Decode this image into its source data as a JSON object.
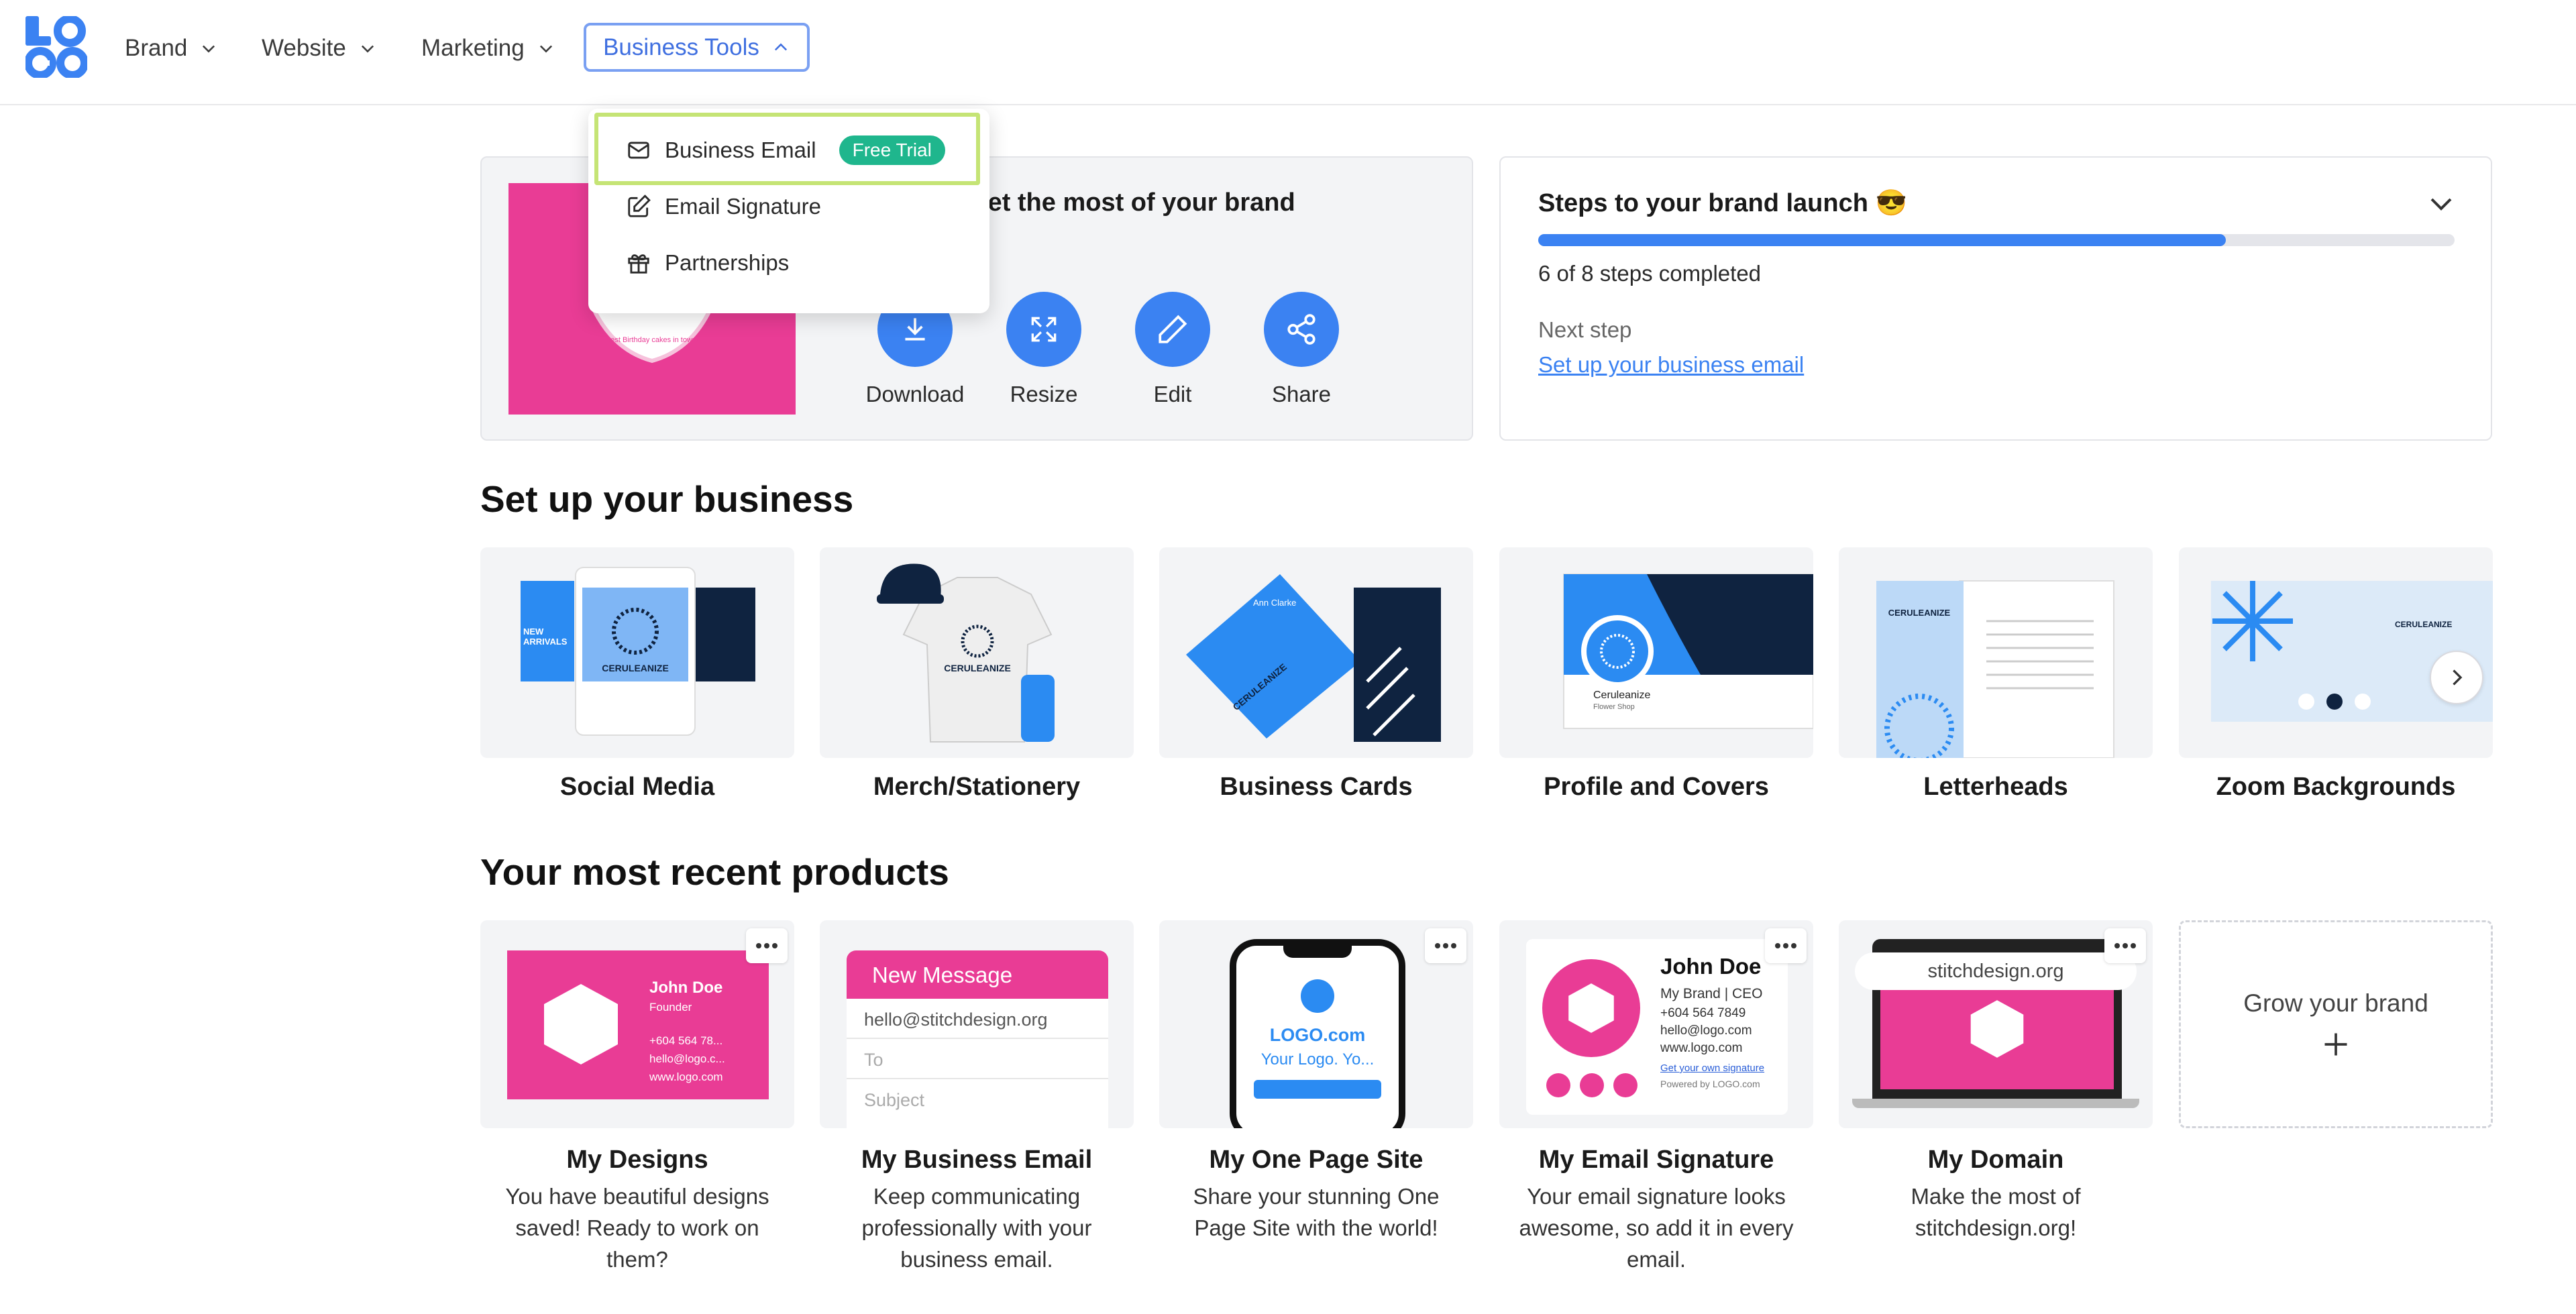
{
  "colors": {
    "accent": "#3b82f2",
    "brand_pink": "#e93c95",
    "badge_green": "#1fb68d",
    "highlight": "#c5e475",
    "navy": "#0f2340"
  },
  "nav": {
    "logo": "LOGO",
    "items": [
      {
        "label": "Brand"
      },
      {
        "label": "Website"
      },
      {
        "label": "Marketing"
      }
    ],
    "active": {
      "label": "Business Tools"
    }
  },
  "dropdown": {
    "items": [
      {
        "label": "Business Email",
        "badge": "Free Trial",
        "icon": "mail-icon"
      },
      {
        "label": "Email Signature",
        "icon": "pen-square-icon"
      },
      {
        "label": "Partnerships",
        "icon": "gift-icon"
      }
    ]
  },
  "brand_panel": {
    "title": "Get the most of your brand",
    "preview_caption": "Best Birthday cakes in town!",
    "actions": [
      {
        "label": "Download",
        "icon": "download-icon"
      },
      {
        "label": "Resize",
        "icon": "resize-icon"
      },
      {
        "label": "Edit",
        "icon": "pencil-icon"
      },
      {
        "label": "Share",
        "icon": "share-icon"
      }
    ]
  },
  "steps": {
    "title": "Steps to your brand launch 😎",
    "progress_fraction": 0.75,
    "count_text": "6 of 8 steps completed",
    "next_label": "Next step",
    "next_link": "Set up your business email"
  },
  "setup": {
    "title": "Set up your business",
    "cards": [
      {
        "label": "Social Media",
        "brand": "CERULEANIZE",
        "tag": "NEW ARRIVALS"
      },
      {
        "label": "Merch/Stationery",
        "brand": "CERULEANIZE"
      },
      {
        "label": "Business Cards",
        "brand": "CERULEANIZE",
        "person": "Ann Clarke"
      },
      {
        "label": "Profile and Covers",
        "brand": "Ceruleanize",
        "sub": "Flower Shop"
      },
      {
        "label": "Letterheads",
        "brand": "CERULEANIZE"
      },
      {
        "label": "Zoom Backgrounds",
        "brand": "CERULEANIZE"
      }
    ]
  },
  "recent": {
    "title": "Your most recent products",
    "cards": [
      {
        "label": "My Designs",
        "desc": [
          "You have beautiful designs",
          "saved! Ready to work on",
          "them?"
        ],
        "preview": {
          "name": "John Doe",
          "role": "Founder",
          "phone": "+604 564 78...",
          "email": "hello@logo.c...",
          "web": "www.logo.com"
        }
      },
      {
        "label": "My Business Email",
        "desc": [
          "Keep communicating",
          "professionally with your",
          "business email."
        ],
        "preview": {
          "header": "New Message",
          "from": "hello@stitchdesign.org",
          "to": "To",
          "subject": "Subject"
        }
      },
      {
        "label": "My One Page Site",
        "desc": [
          "Share your stunning One",
          "Page Site with the world!"
        ],
        "preview": {
          "site": "LOGO.com",
          "tagline": "Your Logo. Yo..."
        }
      },
      {
        "label": "My Email Signature",
        "desc": [
          "Your email signature looks",
          "awesome, so add it in every",
          "email."
        ],
        "preview": {
          "name": "John Doe",
          "role": "My Brand | CEO",
          "phone": "+604 564 7849",
          "email": "hello@logo.com",
          "web": "www.logo.com",
          "cta": "Get your own signature",
          "powered": "Powered by LOGO.com"
        }
      },
      {
        "label": "My Domain",
        "desc": [
          "Make the most of",
          "stitchdesign.org!"
        ],
        "preview": {
          "domain": "stitchdesign.org"
        }
      }
    ],
    "grow": {
      "label": "Grow your brand",
      "icon": "plus-icon"
    }
  }
}
